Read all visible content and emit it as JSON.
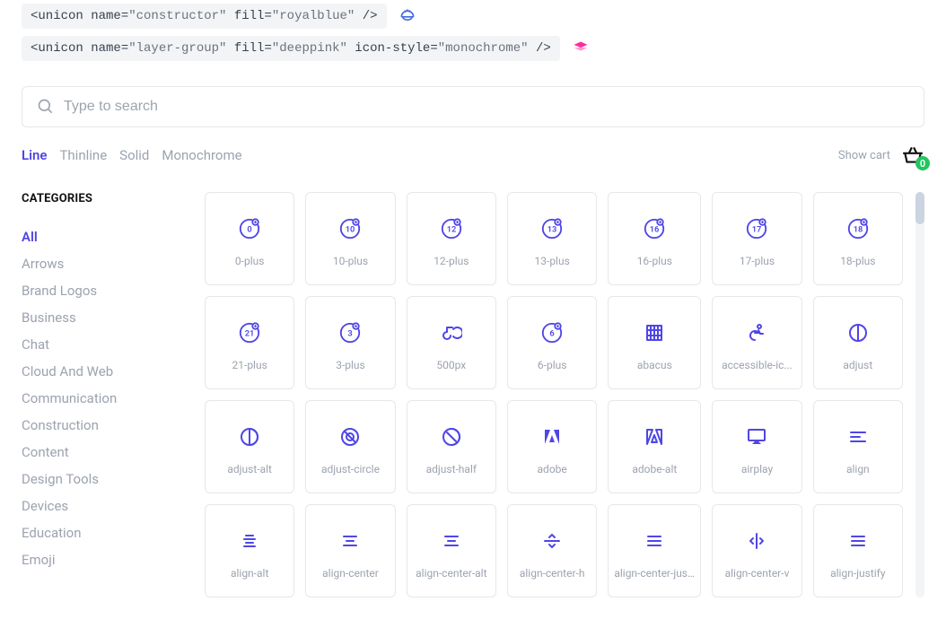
{
  "code_examples": [
    {
      "name": "constructor",
      "fill": "royalblue",
      "icon_style": null
    },
    {
      "name": "layer-group",
      "fill": "deeppink",
      "icon_style": "monochrome"
    }
  ],
  "search": {
    "placeholder": "Type to search"
  },
  "tabs": [
    {
      "label": "Line",
      "active": true
    },
    {
      "label": "Thinline",
      "active": false
    },
    {
      "label": "Solid",
      "active": false
    },
    {
      "label": "Monochrome",
      "active": false
    }
  ],
  "cart": {
    "show_label": "Show cart",
    "count": 0
  },
  "sidebar": {
    "heading": "CATEGORIES",
    "items": [
      {
        "label": "All",
        "active": true
      },
      {
        "label": "Arrows"
      },
      {
        "label": "Brand Logos"
      },
      {
        "label": "Business"
      },
      {
        "label": "Chat"
      },
      {
        "label": "Cloud And Web"
      },
      {
        "label": "Communication"
      },
      {
        "label": "Construction"
      },
      {
        "label": "Content"
      },
      {
        "label": "Design Tools"
      },
      {
        "label": "Devices"
      },
      {
        "label": "Education"
      },
      {
        "label": "Emoji"
      }
    ]
  },
  "icons": [
    {
      "name": "0-plus",
      "glyph": "num-plus",
      "num": "0"
    },
    {
      "name": "10-plus",
      "glyph": "num-plus",
      "num": "10"
    },
    {
      "name": "12-plus",
      "glyph": "num-plus",
      "num": "12"
    },
    {
      "name": "13-plus",
      "glyph": "num-plus",
      "num": "13"
    },
    {
      "name": "16-plus",
      "glyph": "num-plus",
      "num": "16"
    },
    {
      "name": "17-plus",
      "glyph": "num-plus",
      "num": "17"
    },
    {
      "name": "18-plus",
      "glyph": "num-plus",
      "num": "18"
    },
    {
      "name": "21-plus",
      "glyph": "num-plus",
      "num": "21"
    },
    {
      "name": "3-plus",
      "glyph": "num-plus",
      "num": "3"
    },
    {
      "name": "500px",
      "glyph": "500px"
    },
    {
      "name": "6-plus",
      "glyph": "num-plus",
      "num": "6"
    },
    {
      "name": "abacus",
      "glyph": "abacus"
    },
    {
      "name": "accessible-ic...",
      "glyph": "accessible"
    },
    {
      "name": "adjust",
      "glyph": "adjust"
    },
    {
      "name": "adjust-alt",
      "glyph": "adjust-alt"
    },
    {
      "name": "adjust-circle",
      "glyph": "adjust-circle"
    },
    {
      "name": "adjust-half",
      "glyph": "adjust-half"
    },
    {
      "name": "adobe",
      "glyph": "adobe"
    },
    {
      "name": "adobe-alt",
      "glyph": "adobe-alt"
    },
    {
      "name": "airplay",
      "glyph": "airplay"
    },
    {
      "name": "align",
      "glyph": "align"
    },
    {
      "name": "align-alt",
      "glyph": "align-alt"
    },
    {
      "name": "align-center",
      "glyph": "align-center"
    },
    {
      "name": "align-center-alt",
      "glyph": "align-center"
    },
    {
      "name": "align-center-h",
      "glyph": "align-center-h"
    },
    {
      "name": "align-center-justify",
      "glyph": "align-justify"
    },
    {
      "name": "align-center-v",
      "glyph": "align-center-v"
    },
    {
      "name": "align-justify",
      "glyph": "align-justify"
    }
  ],
  "colors": {
    "accent": "#4f46e5",
    "muted": "#9ca3af",
    "border": "#e5e7eb"
  }
}
